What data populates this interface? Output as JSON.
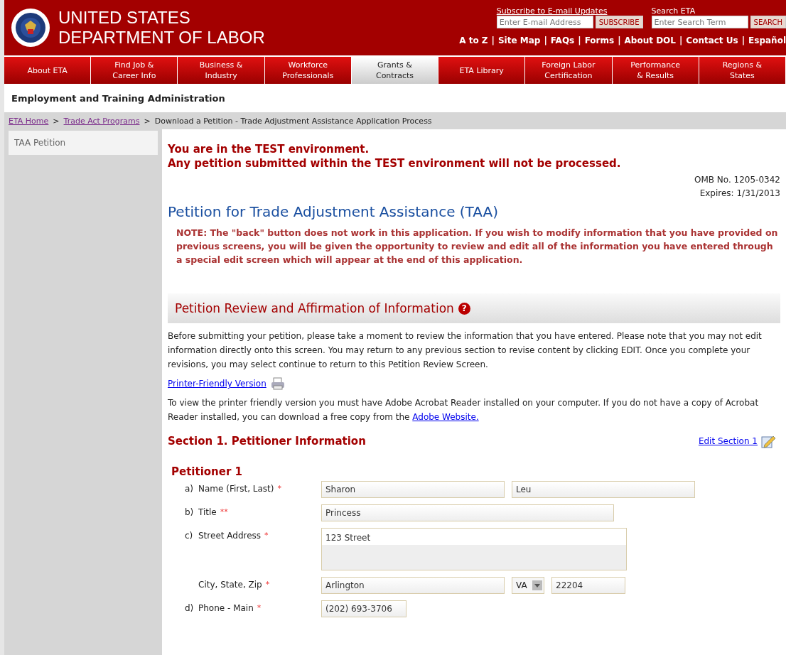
{
  "header": {
    "title_lines": [
      "UNITED STATES",
      "DEPARTMENT OF LABOR"
    ],
    "subscribe": {
      "label": "Subscribe to E-mail Updates",
      "placeholder": "Enter E-mail Address",
      "button": "SUBSCRIBE"
    },
    "search": {
      "label": "Search ETA",
      "placeholder": "Enter Search Term",
      "button": "SEARCH"
    },
    "links": [
      "A to Z",
      "Site Map",
      "FAQs",
      "Forms",
      "About DOL",
      "Contact Us",
      "Español"
    ],
    "link_separator": "|"
  },
  "nav": [
    {
      "lines": [
        "About ETA"
      ],
      "selected": false
    },
    {
      "lines": [
        "Find Job &",
        "Career Info"
      ],
      "selected": false
    },
    {
      "lines": [
        "Business &",
        "Industry"
      ],
      "selected": false
    },
    {
      "lines": [
        "Workforce",
        "Professionals"
      ],
      "selected": false
    },
    {
      "lines": [
        "Grants &",
        "Contracts"
      ],
      "selected": true
    },
    {
      "lines": [
        "ETA Library"
      ],
      "selected": false
    },
    {
      "lines": [
        "Foreign Labor",
        "Certification"
      ],
      "selected": false
    },
    {
      "lines": [
        "Performance",
        "& Results"
      ],
      "selected": false
    },
    {
      "lines": [
        "Regions &",
        "States"
      ],
      "selected": false
    }
  ],
  "agency": "Employment and Training Administration",
  "breadcrumb": {
    "links": [
      "ETA Home",
      "Trade Act Programs"
    ],
    "separator": ">",
    "current": "Download a Petition - Trade Adjustment Assistance Application Process"
  },
  "sidebar": {
    "items": [
      "TAA Petition"
    ]
  },
  "main": {
    "warning": [
      "You are in the TEST environment.",
      "Any petition submitted within the TEST environment will not be processed."
    ],
    "omb": [
      "OMB No. 1205-0342",
      "Expires: 1/31/2013"
    ],
    "title": "Petition for Trade Adjustment Assistance (TAA)",
    "note": "NOTE: The \"back\" button does not work in this application. If you wish to modify information that you have provided on previous screens, you will be given the opportunity to review and edit all of the information you have entered through a special edit screen which will appear at the end of this application.",
    "panel_title": "Petition Review and Affirmation of Information",
    "help_icon": "?",
    "intro": "Before submitting your petition, please take a moment to review the information that you have entered. Please note that you may not edit information directly onto this screen. You may return to any previous section to revise content by clicking EDIT. Once you complete your revisions, you may select continue to return to this Petition Review Screen.",
    "printer_link": "Printer-Friendly Version",
    "acrobat_text": "To view the printer friendly version you must have Adobe Acrobat Reader installed on your computer. If you do not have a copy of Acrobat Reader installed, you can download a free copy from the",
    "acrobat_link": "Adobe Website.",
    "section": {
      "title": "Section 1. Petitioner Information",
      "edit_link": "Edit Section 1"
    },
    "petitioner": "Petitioner 1",
    "rows": [
      {
        "letter": "a)",
        "label": "Name (First, Last)",
        "required": "*",
        "fields": [
          {
            "kind": "medium",
            "value": "Sharon"
          },
          {
            "kind": "medium",
            "value": "Leu"
          }
        ]
      },
      {
        "letter": "b)",
        "label": "Title",
        "required": "**",
        "fields": [
          {
            "kind": "long",
            "value": "Princess"
          }
        ]
      },
      {
        "letter": "c)",
        "label": "Street Address",
        "required": "*",
        "fields": [
          {
            "kind": "textarea",
            "value": "123 Street"
          }
        ]
      },
      {
        "letter": "",
        "label": "City, State, Zip",
        "required": "*",
        "fields": [
          {
            "kind": "medium",
            "value": "Arlington"
          },
          {
            "kind": "select",
            "value": "VA"
          },
          {
            "kind": "zip",
            "value": "22204"
          }
        ]
      },
      {
        "letter": "d)",
        "label": "Phone - Main",
        "required": "*",
        "fields": [
          {
            "kind": "phone",
            "value": "(202) 693-3706"
          }
        ]
      }
    ]
  }
}
